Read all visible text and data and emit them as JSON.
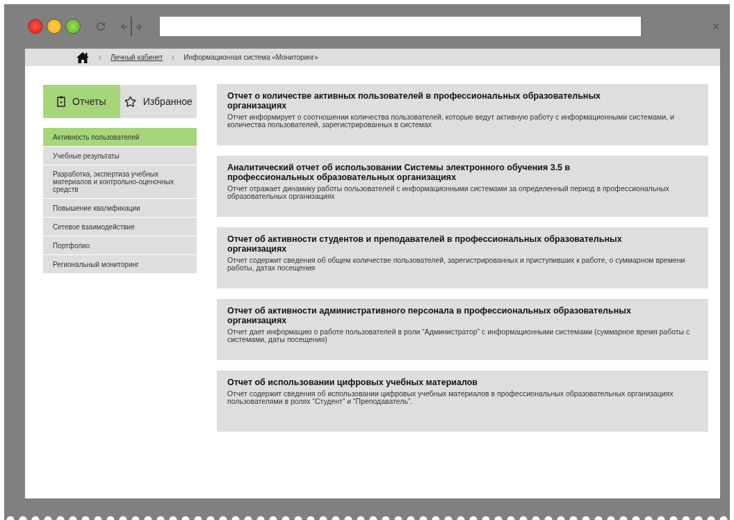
{
  "browser": {
    "close": "×"
  },
  "breadcrumb": [
    {
      "label": "Личный кабинет",
      "kind": "link"
    },
    {
      "label": "Информационная система «Мониторинг»",
      "kind": "text"
    }
  ],
  "tabs": [
    {
      "label": "Отчеты",
      "kind": "report",
      "selected": true
    },
    {
      "label": "Избранное",
      "kind": "star",
      "selected": false
    }
  ],
  "menu": [
    {
      "label": "Активность пользователей",
      "selected": true
    },
    {
      "label": "Учебные результаты",
      "selected": false
    },
    {
      "label": "Разработка, экспертиза учебных материалов и контрольно-оценочных средств",
      "selected": false
    },
    {
      "label": "Повышение квалификации",
      "selected": false
    },
    {
      "label": "Сетевое взаимодействие",
      "selected": false
    },
    {
      "label": "Портфолио",
      "selected": false
    },
    {
      "label": "Региональный мониторинг",
      "selected": false
    }
  ],
  "reports": [
    {
      "title": "Отчет о количестве активных пользователей в профессиональных образовательных организациях",
      "description": "Отчет информирует о соотношении количества пользователей, которые ведут активную работу с информационными системами, и количества пользователей, зарегистрированных в системах"
    },
    {
      "title": "Аналитический отчет об использовании Системы электронного обучения 3.5 в профессиональных образовательных организациях",
      "description": "Отчет отражает динамику работы пользователей с информационными системами за определенный период в профессиональных образовательных организациях"
    },
    {
      "title": "Отчет об активности студентов и преподавателей в профессиональных образовательных организациях",
      "description": "Отчет содержит сведения об общем количестве пользователей, зарегистрированных и приступивших к работе, о суммарном времени работы, датах посещения"
    },
    {
      "title": "Отчет об активности административного персонала в профессиональных образовательных организациях",
      "description": "Отчет дает информацию о работе пользователей в роли “Администратор” с информационными системами (суммарное время работы с системами, даты посещения)"
    },
    {
      "title": "Отчет об использовании цифровых учебных материалов",
      "description": "Отчет содержит сведения об использовании цифровых учебных материалов в профессиональных образовательных организациях пользователями в ролях “Студент” и “Преподаватель”."
    }
  ]
}
